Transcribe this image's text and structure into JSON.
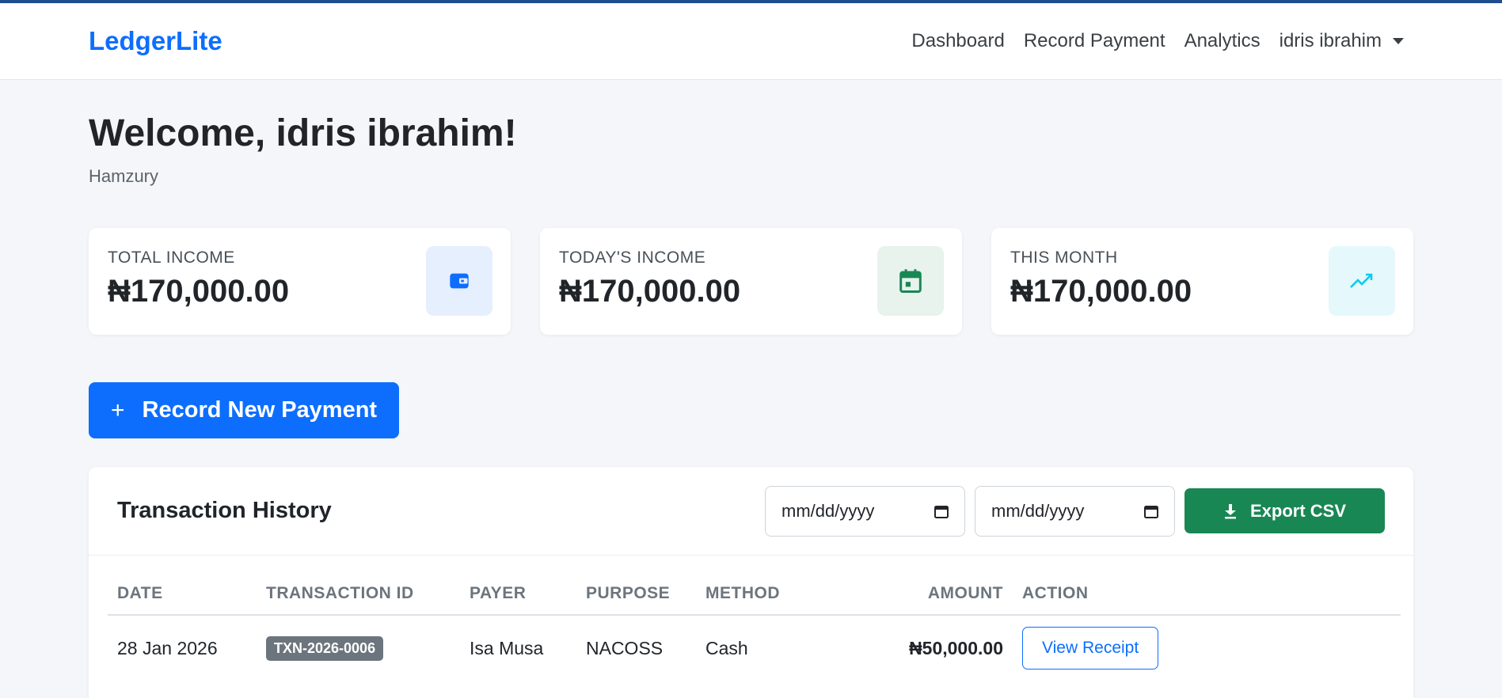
{
  "nav": {
    "brand": "LedgerLite",
    "links": [
      "Dashboard",
      "Record Payment",
      "Analytics"
    ],
    "user": "idris ibrahim"
  },
  "welcome": {
    "title": "Welcome, idris ibrahim!",
    "subtitle": "Hamzury"
  },
  "stats": [
    {
      "label": "TOTAL INCOME",
      "value": "₦170,000.00",
      "icon": "wallet-icon"
    },
    {
      "label": "TODAY'S INCOME",
      "value": "₦170,000.00",
      "icon": "calendar-icon"
    },
    {
      "label": "THIS MONTH",
      "value": "₦170,000.00",
      "icon": "trend-up-icon"
    }
  ],
  "record_button": {
    "icon": "+",
    "label": "Record New Payment"
  },
  "transactions": {
    "title": "Transaction History",
    "from_placeholder": "mm/dd/yyyy",
    "to_placeholder": "mm/dd/yyyy",
    "export_label": "Export CSV",
    "columns": [
      "DATE",
      "TRANSACTION ID",
      "PAYER",
      "PURPOSE",
      "METHOD",
      "AMOUNT",
      "ACTION"
    ],
    "rows": [
      {
        "date": "28 Jan 2026",
        "id": "TXN-2026-0006",
        "payer": "Isa Musa",
        "purpose": "NACOSS",
        "method": "Cash",
        "amount": "₦50,000.00",
        "action": "View Receipt"
      }
    ]
  },
  "colors": {
    "primary": "#0d6efd",
    "success": "#198754",
    "topbar": "#1c4e8f",
    "background": "#f4f6f9"
  }
}
